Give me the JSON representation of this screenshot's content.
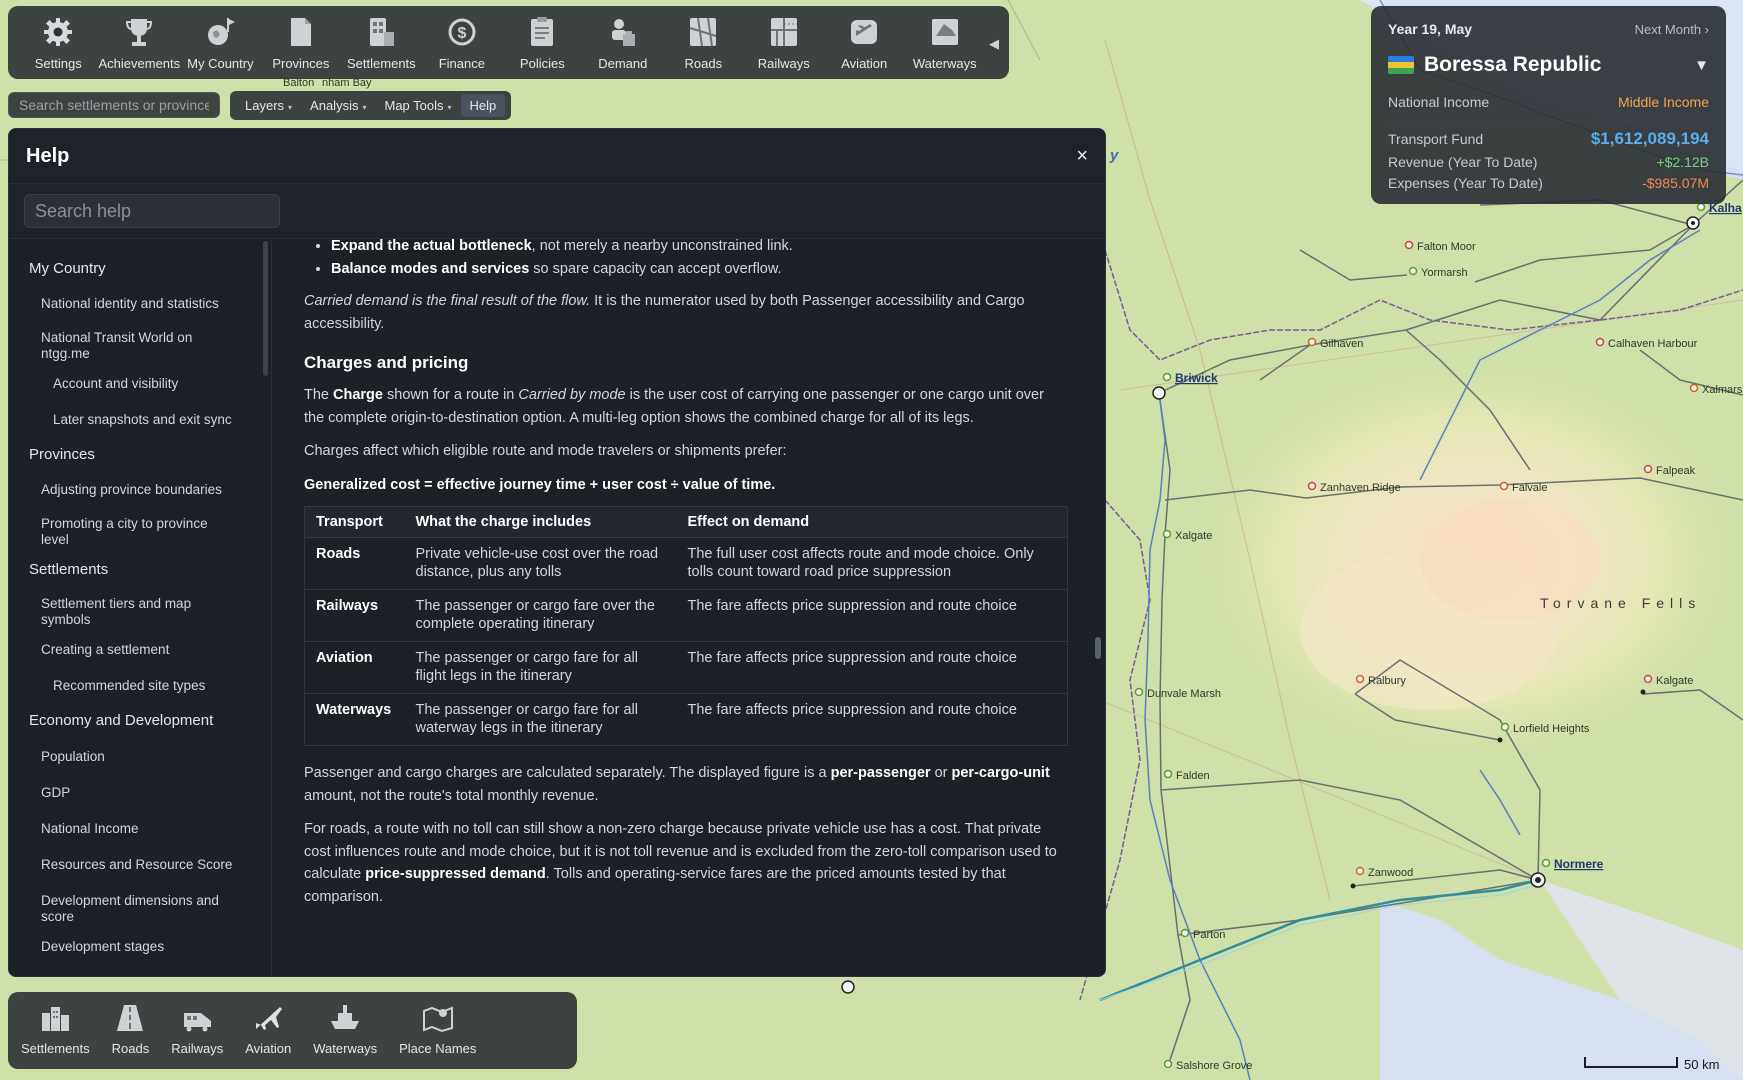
{
  "toolbar": {
    "items": [
      {
        "label": "Settings",
        "icon": "gear-icon"
      },
      {
        "label": "Achievements",
        "icon": "trophy-icon"
      },
      {
        "label": "My Country",
        "icon": "globe-icon"
      },
      {
        "label": "Provinces",
        "icon": "document-icon"
      },
      {
        "label": "Settlements",
        "icon": "buildings-icon"
      },
      {
        "label": "Finance",
        "icon": "dollar-icon"
      },
      {
        "label": "Policies",
        "icon": "clipboard-icon"
      },
      {
        "label": "Demand",
        "icon": "people-icon"
      },
      {
        "label": "Roads",
        "icon": "roads-icon"
      },
      {
        "label": "Railways",
        "icon": "railway-icon"
      },
      {
        "label": "Aviation",
        "icon": "airplane-icon"
      },
      {
        "label": "Waterways",
        "icon": "ship-icon"
      }
    ],
    "collapse": "◀"
  },
  "map_search": {
    "placeholder": "Search settlements or provinces"
  },
  "menus": [
    {
      "label": "Layers",
      "caret": "▾"
    },
    {
      "label": "Analysis",
      "caret": "▾"
    },
    {
      "label": "Map Tools",
      "caret": "▾"
    },
    {
      "label": "Help",
      "caret": ""
    }
  ],
  "country": {
    "date": "Year 19, May",
    "next_month": "Next Month ›",
    "name": "Boressa Republic",
    "dropdown": "▼",
    "national_income_label": "National Income",
    "national_income_value": "Middle Income",
    "transport_fund_label": "Transport Fund",
    "transport_fund_value": "$1,612,089,194",
    "revenue_label": "Revenue (Year To Date)",
    "revenue_value": "+$2.12B",
    "expenses_label": "Expenses (Year To Date)",
    "expenses_value": "-$985.07M",
    "flag_colors": [
      "#2a7de1",
      "#f2c230",
      "#3aa655"
    ]
  },
  "help": {
    "title": "Help",
    "close": "×",
    "search_placeholder": "Search help",
    "nav": [
      {
        "label": "My Country",
        "level": 1
      },
      {
        "label": "National identity and statistics",
        "level": 2
      },
      {
        "label": "National Transit World on ntgg.me",
        "level": 2
      },
      {
        "label": "Account and visibility",
        "level": 3
      },
      {
        "label": "Later snapshots and exit sync",
        "level": 3
      },
      {
        "label": "Provinces",
        "level": 1
      },
      {
        "label": "Adjusting province boundaries",
        "level": 2
      },
      {
        "label": "Promoting a city to province level",
        "level": 2
      },
      {
        "label": "Settlements",
        "level": 1
      },
      {
        "label": "Settlement tiers and map symbols",
        "level": 2
      },
      {
        "label": "Creating a settlement",
        "level": 2
      },
      {
        "label": "Recommended site types",
        "level": 3
      },
      {
        "label": "Economy and Development",
        "level": 1
      },
      {
        "label": "Population",
        "level": 2
      },
      {
        "label": "GDP",
        "level": 2
      },
      {
        "label": "National Income",
        "level": 2
      },
      {
        "label": "Resources and Resource Score",
        "level": 2
      },
      {
        "label": "Development dimensions and score",
        "level": 2
      },
      {
        "label": "Development stages",
        "level": 2
      }
    ],
    "bullet1_bold": "Expand the actual bottleneck",
    "bullet1_rest": ", not merely a nearby unconstrained link.",
    "bullet2_bold": "Balance modes and services",
    "bullet2_rest": " so spare capacity can accept overflow.",
    "carried_italic": "Carried demand is the final result of the flow.",
    "carried_rest": " It is the numerator used by both Passenger accessibility and Cargo accessibility.",
    "section_title": "Charges and pricing",
    "charge_p1": "The ",
    "charge_b": "Charge",
    "charge_p2": " shown for a route in ",
    "charge_i": "Carried by mode",
    "charge_p3": " is the user cost of carrying one passenger or one cargo unit over the complete origin-to-destination option. A multi-leg option shows the combined charge for all of its legs.",
    "affect_text": "Charges affect which eligible route and mode travelers or shipments prefer:",
    "formula": "Generalized cost = effective journey time + user cost ÷ value of time.",
    "table": {
      "headers": [
        "Transport",
        "What the charge includes",
        "Effect on demand"
      ],
      "rows": [
        [
          "Roads",
          "Private vehicle-use cost over the road distance, plus any tolls",
          "The full user cost affects route and mode choice. Only tolls count toward road price suppression"
        ],
        [
          "Railways",
          "The passenger or cargo fare over the complete operating itinerary",
          "The fare affects price suppression and route choice"
        ],
        [
          "Aviation",
          "The passenger or cargo fare for all flight legs in the itinerary",
          "The fare affects price suppression and route choice"
        ],
        [
          "Waterways",
          "The passenger or cargo fare for all waterway legs in the itinerary",
          "The fare affects price suppression and route choice"
        ]
      ]
    },
    "sep_p1": "Passenger and cargo charges are calculated separately. The displayed figure is a ",
    "sep_b1": "per-passenger",
    "sep_p2": " or ",
    "sep_b2": "per-cargo-unit",
    "sep_p3": " amount, not the route's total monthly revenue.",
    "roads_p1": "For roads, a route with no toll can still show a non-zero charge because private vehicle use has a cost. That private cost influences route and mode choice, but it is not toll revenue and is excluded from the zero-toll comparison used to calculate ",
    "roads_b": "price-suppressed demand",
    "roads_p2": ". Tolls and operating-service fares are the priced amounts tested by that comparison."
  },
  "layers": [
    {
      "label": "Settlements",
      "icon": "buildings-icon"
    },
    {
      "label": "Roads",
      "icon": "road-icon"
    },
    {
      "label": "Railways",
      "icon": "train-icon"
    },
    {
      "label": "Aviation",
      "icon": "airplane-icon"
    },
    {
      "label": "Waterways",
      "icon": "ship-icon"
    },
    {
      "label": "Place Names",
      "icon": "map-icon"
    }
  ],
  "map": {
    "region_label": "Torvane Fells",
    "scale_label": "50 km",
    "towns": [
      "Falton Moor",
      "Yormarsh",
      "Gilhaven",
      "Calhaven Harbour",
      "Xalmars",
      "Zanhaven Ridge",
      "Falvale",
      "Falpeak",
      "Xalgate",
      "Dunvale Marsh",
      "Ralbury",
      "Kalgate",
      "Lorfield Heights",
      "Falden",
      "Zanwood",
      "Parton",
      "Salshore Grove"
    ],
    "cities": [
      "Briwick",
      "Normere",
      "Kalha"
    ],
    "fragments": [
      "Balton",
      "nham Bay",
      "y"
    ]
  }
}
